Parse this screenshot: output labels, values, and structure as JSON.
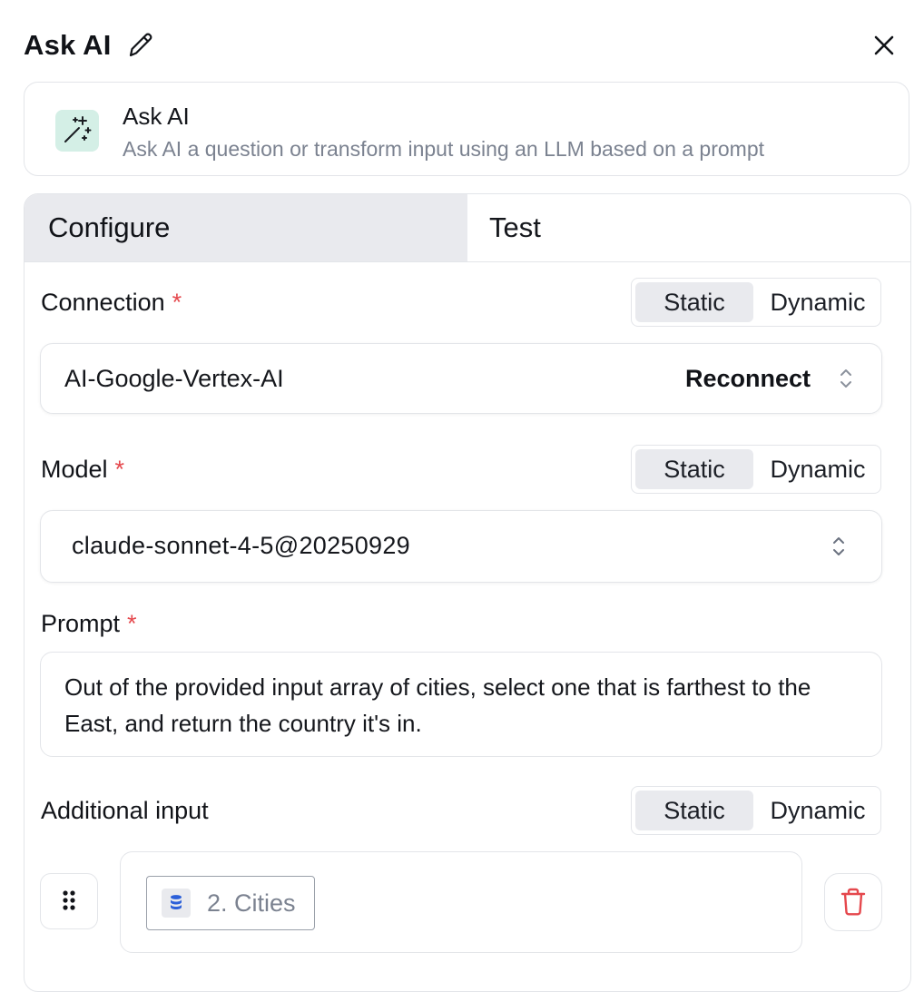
{
  "header": {
    "title": "Ask AI"
  },
  "block": {
    "name": "Ask AI",
    "description": "Ask AI a question or transform input using an LLM based on a prompt"
  },
  "tabs": [
    {
      "label": "Configure",
      "active": true
    },
    {
      "label": "Test",
      "active": false
    }
  ],
  "toggle_options": {
    "static": "Static",
    "dynamic": "Dynamic",
    "selected": "Static"
  },
  "fields": {
    "connection": {
      "label": "Connection",
      "required_mark": "*",
      "value": "AI-Google-Vertex-AI",
      "action": "Reconnect"
    },
    "model": {
      "label": "Model",
      "required_mark": "*",
      "value": "claude-sonnet-4-5@20250929"
    },
    "prompt": {
      "label": "Prompt",
      "required_mark": "*",
      "value": "Out of the provided input array of cities, select one that is farthest to the East, and return the country it's in."
    },
    "additional_input": {
      "label": "Additional input",
      "chip_label": "2. Cities"
    }
  },
  "colors": {
    "required": "#e5484d",
    "block_icon_bg": "#d4efe6",
    "data_icon": "#2b5fd9",
    "delete_icon": "#e5484d",
    "active_tab_bg": "#e9eaee"
  },
  "icons": {
    "title_edit": "pencil-icon",
    "close": "close-icon",
    "block": "magic-wand-icon",
    "select": "chevron-up-down-icon",
    "drag": "drag-handle-icon",
    "chip": "database-icon",
    "delete": "trash-icon"
  }
}
